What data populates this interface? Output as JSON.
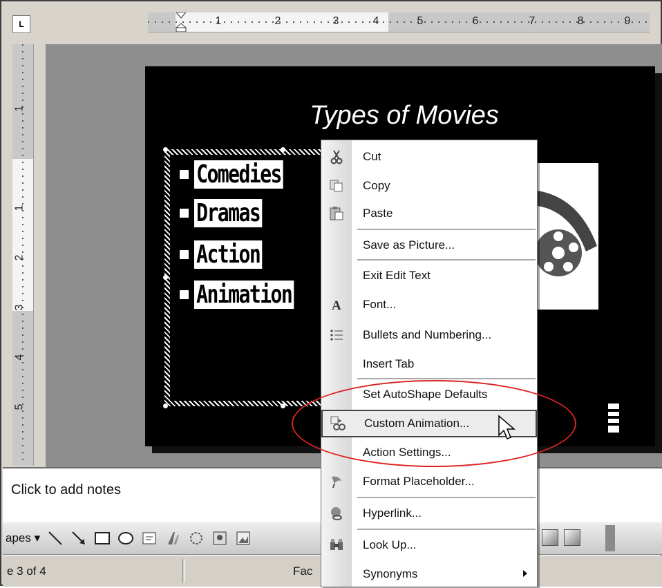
{
  "window": {
    "corner_button": "L"
  },
  "ruler": {
    "horizontal_labels": [
      "1",
      "2",
      "3",
      "4",
      "5",
      "6",
      "7",
      "8",
      "9"
    ],
    "vertical_labels": [
      "1",
      "1",
      "2",
      "3",
      "4",
      "5"
    ]
  },
  "slide": {
    "title": "Types of Movies",
    "bullets": [
      "Comedies",
      "Dramas",
      "Action",
      "Animation"
    ]
  },
  "notes": {
    "placeholder": "Click to add notes"
  },
  "draw_toolbar": {
    "autoshapes_label": "apes ▾"
  },
  "status_bar": {
    "slide_indicator": "e 3 of 4",
    "design": "Fac"
  },
  "context_menu": {
    "items": [
      {
        "label": "Cut",
        "icon": "scissors-icon"
      },
      {
        "label": "Copy",
        "icon": "copy-icon"
      },
      {
        "label": "Paste",
        "icon": "paste-icon"
      },
      {
        "label": "Save as Picture...",
        "icon": ""
      },
      {
        "label": "Exit Edit Text",
        "icon": ""
      },
      {
        "label": "Font...",
        "icon": "font-icon"
      },
      {
        "label": "Bullets and Numbering...",
        "icon": "bullets-icon"
      },
      {
        "label": "Insert Tab",
        "icon": ""
      },
      {
        "label": "Set AutoShape Defaults",
        "icon": ""
      },
      {
        "label": "Custom Animation...",
        "icon": "custom-animation-icon",
        "highlighted": true
      },
      {
        "label": "Action Settings...",
        "icon": ""
      },
      {
        "label": "Format Placeholder...",
        "icon": "format-icon"
      },
      {
        "label": "Hyperlink...",
        "icon": "hyperlink-icon"
      },
      {
        "label": "Look Up...",
        "icon": "lookup-icon"
      },
      {
        "label": "Synonyms",
        "icon": "",
        "submenu": true
      }
    ]
  },
  "colors": {
    "highlight_ring": "#dd2222",
    "slide_background": "#000000",
    "slide_text": "#ffffff"
  }
}
